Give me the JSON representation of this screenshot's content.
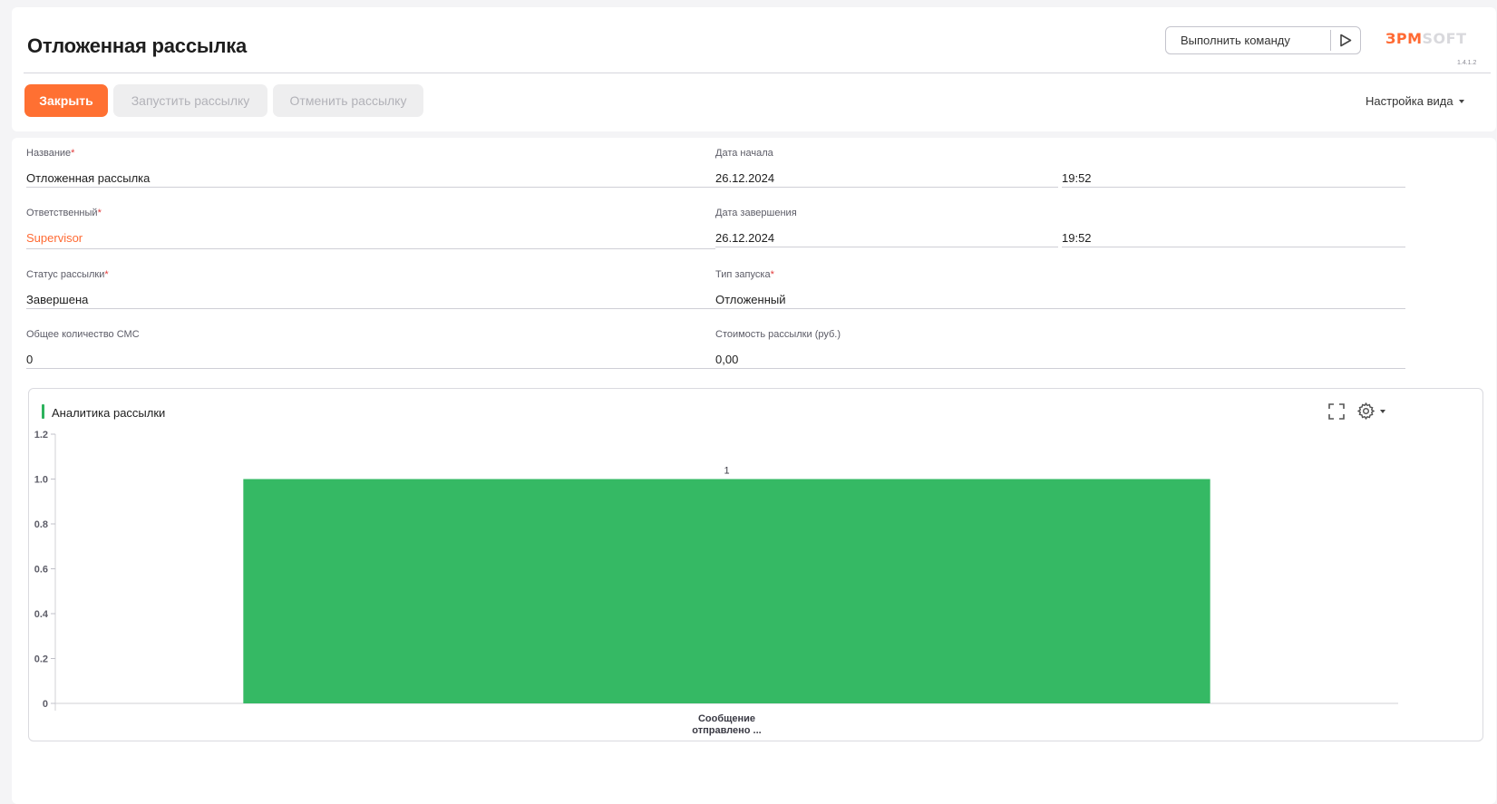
{
  "header": {
    "title": "Отложенная рассылка",
    "command_placeholder": "Выполнить команду",
    "logo_text_brand": "ЗРМ",
    "logo_text_suffix": "SOFT",
    "version": "1.4.1.2",
    "view_settings_label": "Настройка вида"
  },
  "toolbar": {
    "close_label": "Закрыть",
    "start_label": "Запустить рассылку",
    "cancel_label": "Отменить рассылку"
  },
  "form": {
    "name": {
      "label": "Название",
      "value": "Отложенная рассылка"
    },
    "start_date": {
      "label": "Дата начала",
      "date": "26.12.2024",
      "time": "19:52"
    },
    "owner": {
      "label": "Ответственный",
      "value": "Supervisor"
    },
    "end_date": {
      "label": "Дата завершения",
      "date": "26.12.2024",
      "time": "19:52"
    },
    "status": {
      "label": "Статус рассылки",
      "value": "Завершена"
    },
    "launch_type": {
      "label": "Тип запуска",
      "value": "Отложенный"
    },
    "sms_count": {
      "label": "Общее количество СМС",
      "value": "0"
    },
    "cost": {
      "label": "Стоимость рассылки (руб.)",
      "value": "0,00"
    }
  },
  "widget": {
    "title": "Аналитика рассылки",
    "accent_color": "#2db35d"
  },
  "colors": {
    "brand": "#ff6a33",
    "bar": "#35b964",
    "required": "#e23c3c"
  },
  "chart_data": {
    "type": "bar",
    "categories": [
      "Сообщение отправлено ..."
    ],
    "category_lines": [
      [
        "Сообщение",
        "отправлено ..."
      ]
    ],
    "values": [
      1
    ],
    "data_labels": [
      "1"
    ],
    "yticks": [
      "0",
      "0.2",
      "0.4",
      "0.6",
      "0.8",
      "1.0",
      "1.2"
    ],
    "ylim": [
      0,
      1.2
    ],
    "grid": false,
    "title": "",
    "xlabel": "",
    "ylabel": ""
  }
}
